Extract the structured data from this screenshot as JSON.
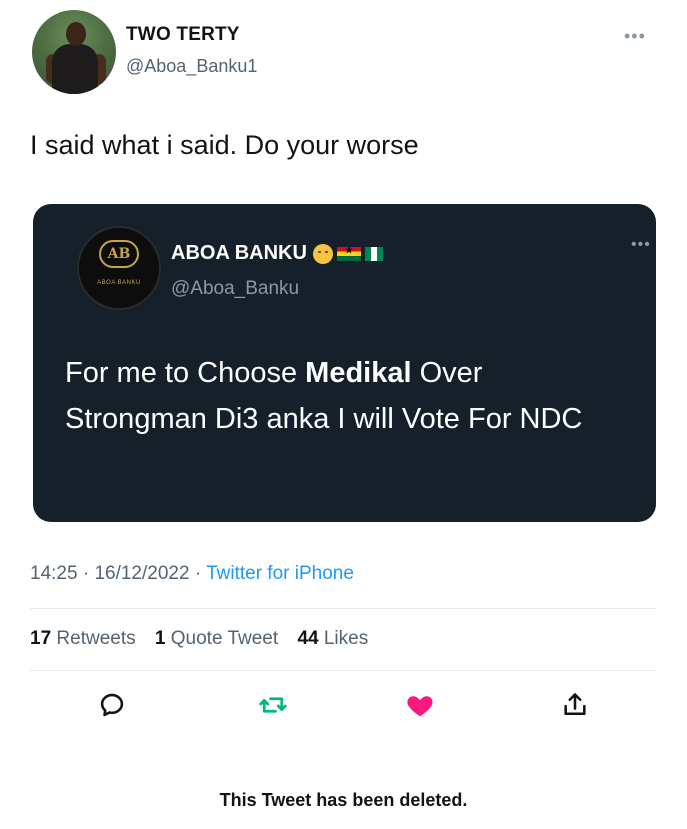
{
  "user": {
    "name": "TWO TERTY",
    "handle": "@Aboa_Banku1"
  },
  "tweet": {
    "text": "I said what i said. Do your worse"
  },
  "quoted": {
    "name": "ABOA BANKU",
    "handle": "@Aboa_Banku",
    "avatar_monogram": "AB",
    "avatar_caption": "ABOA BANKU",
    "text_part1": "For me to Choose ",
    "text_bold": "Medikal",
    "text_part2": " Over Strongman Di3 anka I will Vote For NDC"
  },
  "meta": {
    "time": "14:25",
    "date": "16/12/2022",
    "source": "Twitter for iPhone"
  },
  "stats": {
    "retweets_count": "17",
    "retweets_label": "Retweets",
    "quotes_count": "1",
    "quotes_label": "Quote Tweet",
    "likes_count": "44",
    "likes_label": "Likes"
  },
  "colors": {
    "like": "#f91880",
    "retweet": "#00ba7c",
    "link": "#1d9bf0",
    "quote_bg": "#15202b"
  },
  "footer": {
    "deleted_notice": "This Tweet has been deleted."
  }
}
